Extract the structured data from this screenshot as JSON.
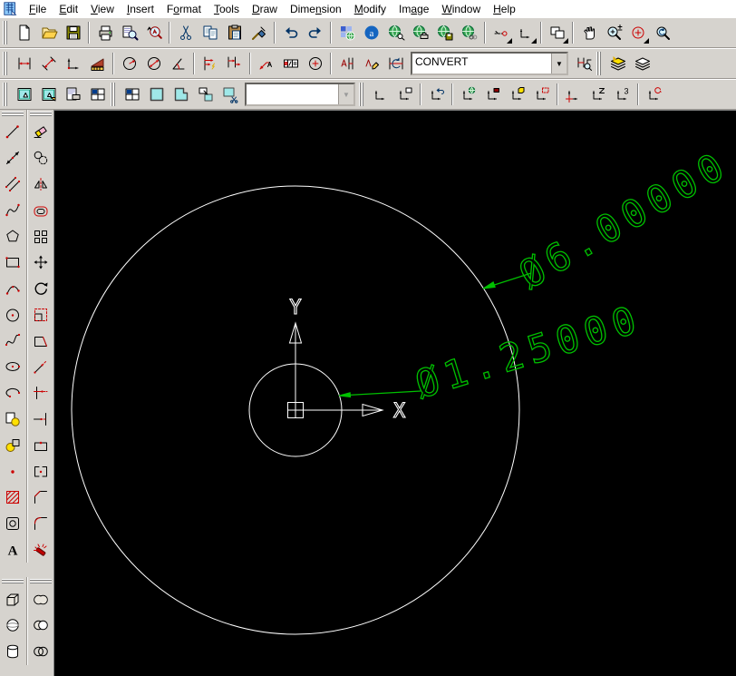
{
  "menu": {
    "items": [
      {
        "id": "file",
        "pre": "",
        "key": "F",
        "post": "ile"
      },
      {
        "id": "edit",
        "pre": "",
        "key": "E",
        "post": "dit"
      },
      {
        "id": "view",
        "pre": "",
        "key": "V",
        "post": "iew"
      },
      {
        "id": "insert",
        "pre": "",
        "key": "I",
        "post": "nsert"
      },
      {
        "id": "format",
        "pre": "F",
        "key": "o",
        "post": "rmat"
      },
      {
        "id": "tools",
        "pre": "",
        "key": "T",
        "post": "ools"
      },
      {
        "id": "draw",
        "pre": "",
        "key": "D",
        "post": "raw"
      },
      {
        "id": "dimension",
        "pre": "Dime",
        "key": "n",
        "post": "sion"
      },
      {
        "id": "modify",
        "pre": "",
        "key": "M",
        "post": "odify"
      },
      {
        "id": "image",
        "pre": "Im",
        "key": "a",
        "post": "ge"
      },
      {
        "id": "window",
        "pre": "",
        "key": "W",
        "post": "indow"
      },
      {
        "id": "help",
        "pre": "",
        "key": "H",
        "post": "elp"
      }
    ]
  },
  "icons": {
    "dropdown_arrow": "▼"
  },
  "toolbars": {
    "standard": {
      "items": [
        {
          "grip": true
        },
        {
          "name": "new",
          "icon": "new-file"
        },
        {
          "name": "open",
          "icon": "open-folder"
        },
        {
          "name": "save",
          "icon": "save"
        },
        {
          "sep": true
        },
        {
          "name": "print",
          "icon": "print"
        },
        {
          "name": "print-preview",
          "icon": "print-preview"
        },
        {
          "name": "spelling",
          "icon": "spelling"
        },
        {
          "sep": true
        },
        {
          "name": "cut",
          "icon": "cut"
        },
        {
          "name": "copy",
          "icon": "copy"
        },
        {
          "name": "paste",
          "icon": "paste"
        },
        {
          "name": "match-properties",
          "icon": "match-properties"
        },
        {
          "sep": true
        },
        {
          "name": "undo",
          "icon": "undo"
        },
        {
          "name": "redo",
          "icon": "redo"
        },
        {
          "sep": true
        },
        {
          "name": "internet-tools",
          "icon": "internet-tools"
        },
        {
          "name": "autodesk-point-a",
          "icon": "autodesk-point-a"
        },
        {
          "name": "browse-web",
          "icon": "browse-web"
        },
        {
          "name": "eplot-web",
          "icon": "eplot-web"
        },
        {
          "name": "save-to-web",
          "icon": "save-to-web"
        },
        {
          "name": "insert-hyperlink",
          "icon": "insert-hyperlink"
        },
        {
          "sep": true
        },
        {
          "name": "tracking",
          "icon": "tracking-flyout",
          "flyout": true
        },
        {
          "name": "ucs-point",
          "icon": "ucs-point-flyout",
          "flyout": true
        },
        {
          "sep": true
        },
        {
          "name": "named-views",
          "icon": "named-views-flyout",
          "flyout": true
        },
        {
          "sep": true
        },
        {
          "name": "pan-realtime",
          "icon": "pan-realtime"
        },
        {
          "name": "zoom-realtime",
          "icon": "zoom-realtime"
        },
        {
          "name": "zoom-window",
          "icon": "zoom-window-flyout",
          "flyout": true
        },
        {
          "name": "zoom-previous",
          "icon": "zoom-previous"
        }
      ]
    },
    "dimension": {
      "style_combo": {
        "value": "CONVERT"
      },
      "items": [
        {
          "grip": true
        },
        {
          "name": "dim-linear",
          "icon": "dim-linear"
        },
        {
          "name": "dim-aligned",
          "icon": "dim-aligned"
        },
        {
          "name": "dim-ordinate",
          "icon": "dim-ordinate"
        },
        {
          "name": "quick-dimension",
          "icon": "quick-dimension"
        },
        {
          "sep": true
        },
        {
          "name": "dim-radius",
          "icon": "dim-radius"
        },
        {
          "name": "dim-diameter",
          "icon": "dim-diameter"
        },
        {
          "name": "dim-angular",
          "icon": "dim-angular"
        },
        {
          "sep": true
        },
        {
          "name": "dim-baseline",
          "icon": "dim-baseline"
        },
        {
          "name": "dim-continue",
          "icon": "dim-continue"
        },
        {
          "sep": true
        },
        {
          "name": "quick-leader",
          "icon": "quick-leader"
        },
        {
          "name": "dim-tolerance",
          "icon": "dim-tolerance"
        },
        {
          "name": "dim-center-mark",
          "icon": "dim-center-mark"
        },
        {
          "sep": true
        },
        {
          "name": "dim-edit",
          "icon": "dim-edit"
        },
        {
          "name": "dim-text-edit",
          "icon": "dim-text-edit"
        },
        {
          "name": "dim-update",
          "icon": "dim-update"
        },
        {
          "combo": true,
          "name": "dim-style-combo",
          "bind": "toolbars.dimension.style_combo.value",
          "width": 170
        },
        {
          "name": "dim-style",
          "icon": "dim-style-apply"
        }
      ]
    },
    "layers": {
      "items": [
        {
          "grip": true
        },
        {
          "name": "make-layer-current",
          "icon": "make-layer-current"
        },
        {
          "name": "layer-previous",
          "icon": "layer-previous"
        }
      ]
    },
    "layouts": {
      "items": [
        {
          "grip": true
        },
        {
          "name": "new-layout",
          "icon": "new-layout"
        },
        {
          "name": "layout-from-template",
          "icon": "layout-from-template"
        },
        {
          "name": "page-setup",
          "icon": "page-setup"
        },
        {
          "name": "display-viewports",
          "icon": "viewports-dialog"
        }
      ]
    },
    "viewports": {
      "scale_combo": {
        "value": ""
      },
      "items": [
        {
          "grip": true
        },
        {
          "name": "viewports-dialog",
          "icon": "viewports-dialog"
        },
        {
          "name": "single-viewport",
          "icon": "single-viewport"
        },
        {
          "name": "polygonal-viewport",
          "icon": "polygonal-viewport"
        },
        {
          "name": "convert-to-viewport",
          "icon": "convert-to-viewport"
        },
        {
          "name": "clip-viewport",
          "icon": "clip-viewport"
        },
        {
          "combo": true,
          "name": "viewport-scale-combo",
          "bind": "toolbars.viewports.scale_combo.value",
          "width": 118,
          "disabled": true
        }
      ]
    },
    "ucs": {
      "items": [
        {
          "grip": true
        },
        {
          "name": "ucs",
          "icon": "ucs"
        },
        {
          "name": "ucs-dialog",
          "icon": "ucs-dialog"
        },
        {
          "sep": true
        },
        {
          "name": "ucs-previous",
          "icon": "ucs-previous"
        },
        {
          "sep": true
        },
        {
          "name": "ucs-world",
          "icon": "ucs-world"
        },
        {
          "name": "ucs-object",
          "icon": "ucs-object"
        },
        {
          "name": "ucs-face",
          "icon": "ucs-face"
        },
        {
          "name": "ucs-view",
          "icon": "ucs-view"
        },
        {
          "sep": true
        },
        {
          "name": "ucs-origin",
          "icon": "ucs-origin"
        },
        {
          "name": "ucs-zaxis",
          "icon": "ucs-zaxis"
        },
        {
          "name": "ucs-3point",
          "icon": "ucs-3point"
        },
        {
          "sep": true
        },
        {
          "name": "ucs-rotate-x",
          "icon": "ucs-rotate-x"
        }
      ]
    },
    "draw": {
      "items": [
        {
          "grip": true
        },
        {
          "name": "line",
          "icon": "line"
        },
        {
          "name": "construction-line",
          "icon": "construction-line"
        },
        {
          "name": "multiline",
          "icon": "multiline"
        },
        {
          "name": "polyline",
          "icon": "polyline"
        },
        {
          "name": "polygon",
          "icon": "polygon"
        },
        {
          "name": "rectangle",
          "icon": "rectangle"
        },
        {
          "name": "arc",
          "icon": "arc"
        },
        {
          "name": "circle",
          "icon": "circle"
        },
        {
          "name": "spline",
          "icon": "spline"
        },
        {
          "name": "ellipse",
          "icon": "ellipse"
        },
        {
          "name": "ellipse-arc",
          "icon": "ellipse-arc"
        },
        {
          "name": "insert-block",
          "icon": "insert-block"
        },
        {
          "name": "make-block",
          "icon": "make-block"
        },
        {
          "name": "point",
          "icon": "point"
        },
        {
          "name": "hatch",
          "icon": "hatch"
        },
        {
          "name": "region",
          "icon": "region"
        },
        {
          "name": "text",
          "icon": "text"
        }
      ]
    },
    "modify": {
      "items": [
        {
          "grip": true
        },
        {
          "name": "erase",
          "icon": "erase"
        },
        {
          "name": "copy-object",
          "icon": "copy-object"
        },
        {
          "name": "mirror",
          "icon": "mirror"
        },
        {
          "name": "offset",
          "icon": "offset"
        },
        {
          "name": "array",
          "icon": "array"
        },
        {
          "name": "move",
          "icon": "move"
        },
        {
          "name": "rotate",
          "icon": "rotate"
        },
        {
          "name": "scale",
          "icon": "scale"
        },
        {
          "name": "stretch",
          "icon": "stretch"
        },
        {
          "name": "lengthen",
          "icon": "lengthen"
        },
        {
          "name": "trim",
          "icon": "trim"
        },
        {
          "name": "extend",
          "icon": "extend"
        },
        {
          "name": "break",
          "icon": "break"
        },
        {
          "name": "break-at-point",
          "icon": "break-at-point"
        },
        {
          "name": "chamfer",
          "icon": "chamfer"
        },
        {
          "name": "fillet",
          "icon": "fillet"
        },
        {
          "name": "explode",
          "icon": "explode"
        }
      ]
    },
    "solids": {
      "items": [
        {
          "grip": true
        },
        {
          "name": "box",
          "icon": "solid-box"
        },
        {
          "name": "sphere",
          "icon": "sphere"
        },
        {
          "name": "cylinder",
          "icon": "cylinder"
        }
      ]
    },
    "solids_editing": {
      "items": [
        {
          "grip": true
        },
        {
          "name": "union",
          "icon": "union"
        },
        {
          "name": "subtract",
          "icon": "subtract"
        },
        {
          "name": "intersect",
          "icon": "intersect"
        }
      ]
    }
  },
  "canvas": {
    "background": "#000000",
    "geometry_color": "#ffffff",
    "dimension_color": "#00c000",
    "ucs_x_label": "X",
    "ucs_y_label": "Y",
    "dimensions": {
      "outer": {
        "text": "Ø6.00000"
      },
      "inner": {
        "text": "Ø1.25000"
      }
    }
  }
}
